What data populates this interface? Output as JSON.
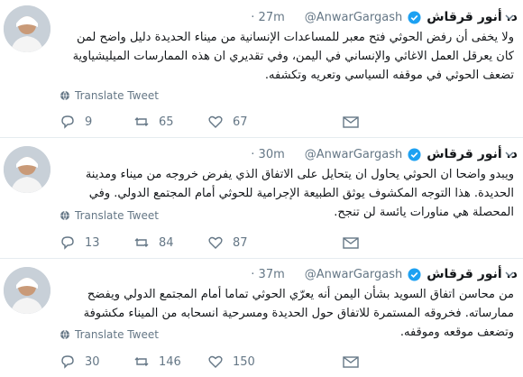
{
  "tweets": [
    {
      "author_name": "د. أنور قرقاش",
      "handle": "@AnwarGargash",
      "time": "· 27m",
      "text": "ولا يخفى أن رفض الحوثي فتح معبر للمساعدات الإنسانية من ميناء الحديدة دليل واضح لمن كان يعرقل العمل الاغاثي والإنساني في اليمن، وفي تقديري ان هذه الممارسات الميليشياوية تضعف الحوثي في موقفه السياسي وتعريه وتكشفه.",
      "translate_label": "Translate Tweet",
      "replies": "9",
      "retweets": "65",
      "likes": "67"
    },
    {
      "author_name": "د. أنور قرقاش",
      "handle": "@AnwarGargash",
      "time": "· 30m",
      "text": "ويبدو واضحا ان الحوثي يحاول ان يتحايل على الاتفاق الذي يفرض خروجه من ميناء ومدينة الحديدة. هذا التوجه المكشوف يوثق الطبيعة الإجرامية للحوثي أمام المجتمع الدولي. وفي المحصلة هي مناورات يائسة لن تنجح.",
      "translate_label": "Translate Tweet",
      "replies": "13",
      "retweets": "84",
      "likes": "87"
    },
    {
      "author_name": "د. أنور قرقاش",
      "handle": "@AnwarGargash",
      "time": "· 37m",
      "text": "من محاسن اتفاق السويد بشأن اليمن أنه يعرّي الحوثي تماما أمام المجتمع الدولي ويفضح ممارساته. فخروقه المستمرة للاتفاق حول الحديدة ومسرحية انسحابه من الميناء مكشوفة وتضعف موقعه وموقفه.",
      "translate_label": "Translate Tweet",
      "replies": "30",
      "retweets": "146",
      "likes": "150"
    }
  ],
  "colors": {
    "verified": "#1da1f2",
    "muted": "#657786",
    "divider": "#e6ecf0"
  }
}
